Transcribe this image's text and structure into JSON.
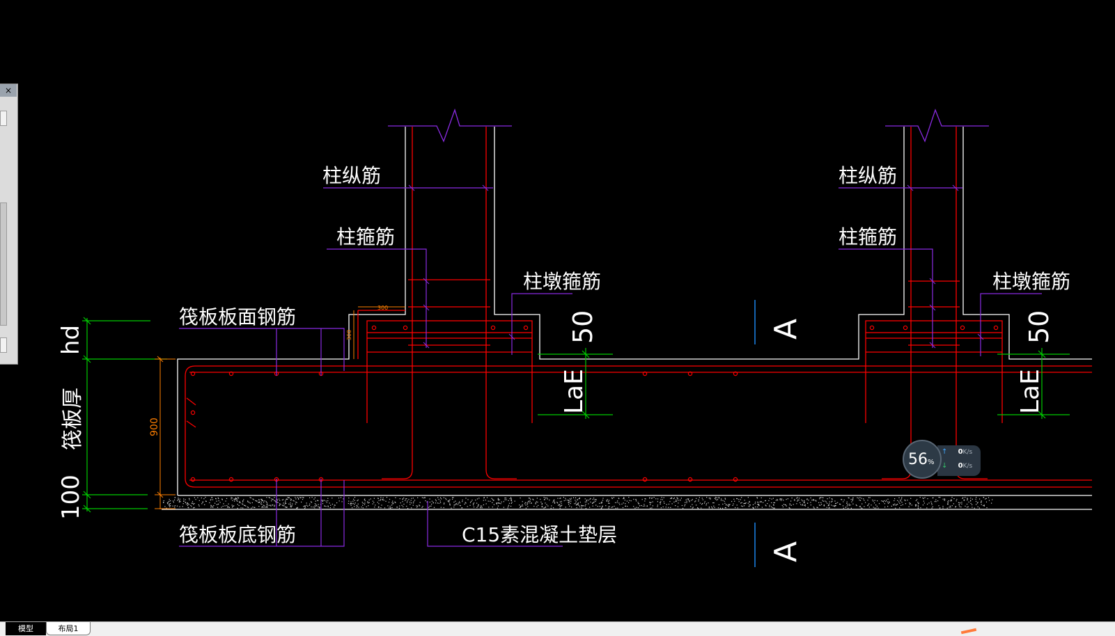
{
  "labels": {
    "zhu_zong_jin_1": "柱纵筋",
    "zhu_gu_jin_1": "柱箍筋",
    "zhu_dun_gu_jin_1": "柱墩箍筋",
    "zhu_zong_jin_2": "柱纵筋",
    "zhu_gu_jin_2": "柱箍筋",
    "zhu_dun_gu_jin_2": "柱墩箍筋",
    "fa_mian_gangjin": "筏板板面钢筋",
    "fa_di_gangjin": "筏板板底钢筋",
    "dianceng": "C15素混凝土垫层",
    "fa_ban_hou": "筏板厚",
    "section_mark_top": "A",
    "section_mark_bottom": "A"
  },
  "dimensions": {
    "hd": "hd",
    "thickness": "900",
    "pad": "100",
    "lae_1": "LaE",
    "lae_2": "LaE",
    "fifty_1": "50",
    "fifty_2": "50",
    "small_1": "300",
    "small_2": "300"
  },
  "tabs": {
    "model": "模型",
    "layout1": "布局1"
  },
  "palette": {
    "title": "×"
  },
  "network_widget": {
    "cpu_percent": "56",
    "percent_sign": "%",
    "upload_value": "0",
    "download_value": "0",
    "speed_unit": "K/s",
    "up_arrow": "↑",
    "down_arrow": "↓"
  },
  "colors": {
    "background": "#000000",
    "outline": "#ffffff",
    "rebar": "#ff0000",
    "leader": "#8a2be2",
    "dimension": "#00cc00",
    "small_dim": "#ff7f00",
    "section": "#1e90ff"
  }
}
